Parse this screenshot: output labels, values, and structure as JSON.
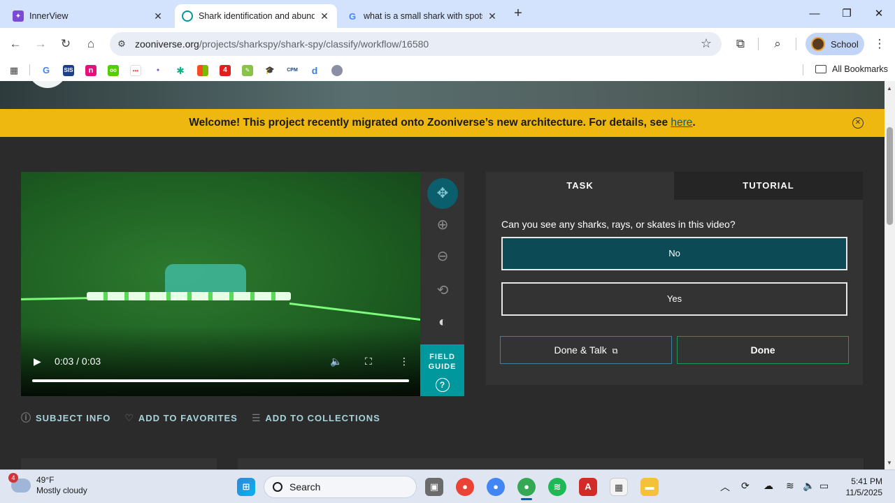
{
  "browser": {
    "tabs": [
      {
        "title": "InnerView",
        "active": false
      },
      {
        "title": "Shark identification and abunda",
        "active": true
      },
      {
        "title": "what is a small shark with spots",
        "active": false
      }
    ],
    "url_host": "zooniverse.org",
    "url_path": "/projects/sharkspy/shark-spy/classify/workflow/16580",
    "profile_label": "School",
    "all_bookmarks_label": "All Bookmarks",
    "bookmark_icons": [
      "google-icon",
      "sis-icon",
      "n-icon",
      "owl-icon",
      "dots-icon",
      "dots2-icon",
      "flower-icon",
      "microsoft-icon",
      "four-icon",
      "green-icon",
      "cap-icon",
      "cpm-icon",
      "d-icon",
      "globe-icon"
    ]
  },
  "banner": {
    "text": "Welcome! This project recently migrated onto Zooniverse’s new architecture. For details, see ",
    "link": "here",
    "suffix": "."
  },
  "video": {
    "time": "0:03 / 0:03",
    "progress": 1.0
  },
  "sidebar": {
    "field_guide_line1": "FIELD",
    "field_guide_line2": "GUIDE"
  },
  "meta": {
    "subject_info": "SUBJECT INFO",
    "add_favorites": "ADD TO FAVORITES",
    "add_collections": "ADD TO COLLECTIONS"
  },
  "task": {
    "tab_task": "TASK",
    "tab_tutorial": "TUTORIAL",
    "question": "Can you see any sharks, rays, or skates in this video?",
    "answers": [
      {
        "label": "No",
        "selected": true
      },
      {
        "label": "Yes",
        "selected": false
      }
    ],
    "done_talk": "Done & Talk",
    "done": "Done"
  },
  "taskbar": {
    "weather_badge": "4",
    "temperature": "49°F",
    "condition": "Mostly cloudy",
    "search_label": "Search",
    "time": "5:41 PM",
    "date": "11/5/2025"
  },
  "colors": {
    "banner": "#efb810",
    "selected_answer": "#0c4b55",
    "field_guide": "#00979d",
    "done_border": "#1f9a53"
  }
}
